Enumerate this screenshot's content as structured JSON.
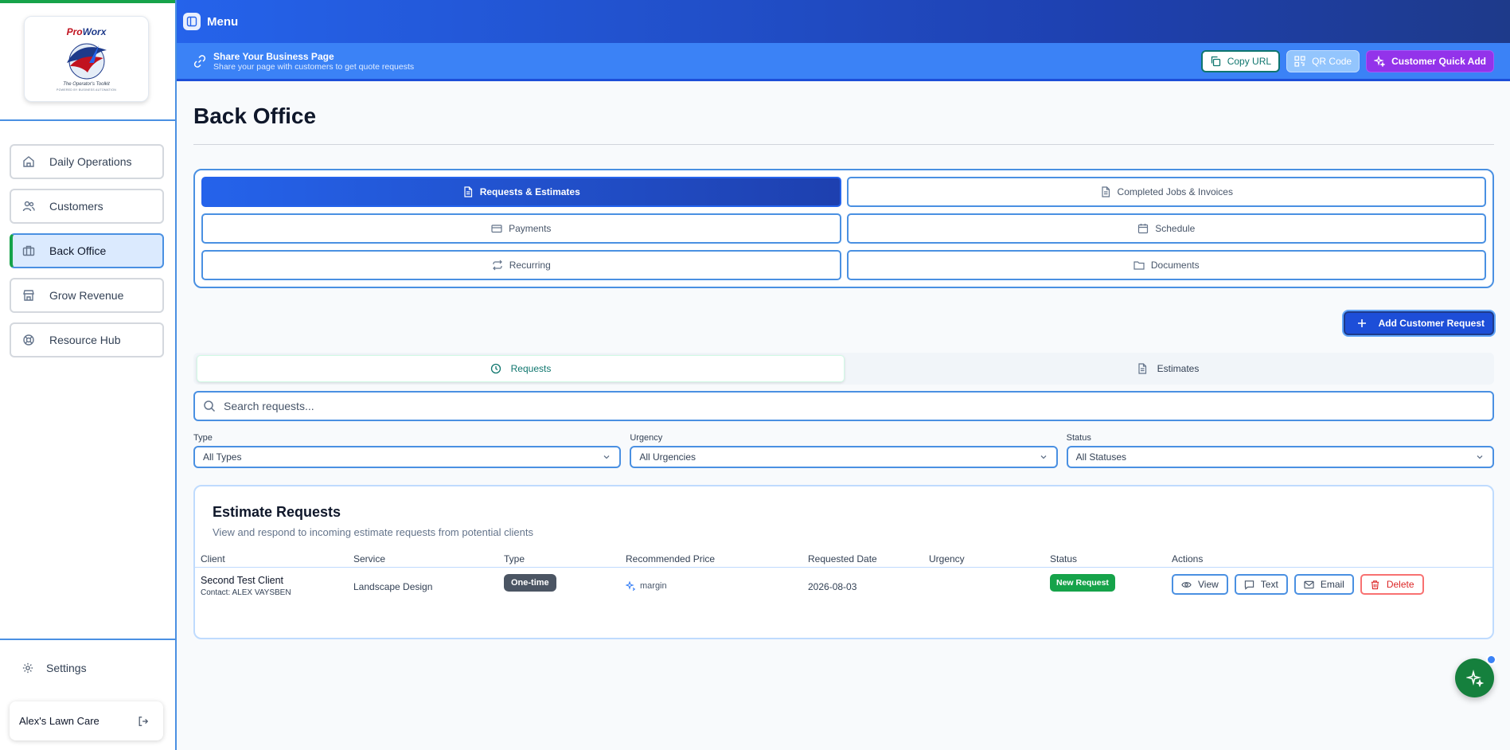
{
  "sidebar": {
    "logo": {
      "brand_a": "Pro",
      "brand_b": "Worx",
      "tagline": "The Operator's Toolkit",
      "subline": "POWERED BY BUSINESS AUTOMATION"
    },
    "items": [
      {
        "label": "Daily Operations",
        "icon": "home-icon"
      },
      {
        "label": "Customers",
        "icon": "users-icon"
      },
      {
        "label": "Back Office",
        "icon": "briefcase-icon",
        "active": true
      },
      {
        "label": "Grow Revenue",
        "icon": "store-icon"
      },
      {
        "label": "Resource Hub",
        "icon": "lifebuoy-icon"
      }
    ],
    "settings_label": "Settings",
    "business_name": "Alex's Lawn Care"
  },
  "topbar": {
    "menu_label": "Menu"
  },
  "sharebar": {
    "title": "Share Your Business Page",
    "subtitle": "Share your page with customers to get quote requests",
    "copy_url": "Copy URL",
    "qr_code": "QR Code",
    "quick_add": "Customer Quick Add"
  },
  "page": {
    "title": "Back Office"
  },
  "tabs": [
    {
      "label": "Requests & Estimates",
      "icon": "file-icon",
      "active": true
    },
    {
      "label": "Completed Jobs & Invoices",
      "icon": "file-icon"
    },
    {
      "label": "Payments",
      "icon": "credit-card-icon"
    },
    {
      "label": "Schedule",
      "icon": "calendar-icon"
    },
    {
      "label": "Recurring",
      "icon": "repeat-icon"
    },
    {
      "label": "Documents",
      "icon": "folder-icon"
    }
  ],
  "add_request_label": "Add Customer Request",
  "subtabs": [
    {
      "label": "Requests",
      "icon": "clock-icon",
      "active": true
    },
    {
      "label": "Estimates",
      "icon": "file-icon"
    }
  ],
  "search": {
    "placeholder": "Search requests..."
  },
  "filters": [
    {
      "label": "Type",
      "value": "All Types"
    },
    {
      "label": "Urgency",
      "value": "All Urgencies"
    },
    {
      "label": "Status",
      "value": "All Statuses"
    }
  ],
  "card": {
    "title": "Estimate Requests",
    "subtitle": "View and respond to incoming estimate requests from potential clients",
    "columns": [
      "Client",
      "Service",
      "Type",
      "Recommended Price",
      "Requested Date",
      "Urgency",
      "Status",
      "Actions"
    ],
    "rows": [
      {
        "client": "Second Test Client",
        "contact": "Contact: ALEX VAYSBEN",
        "service": "Landscape Design",
        "type": "One-time",
        "price": "margin",
        "date": "2026-08-03",
        "urgency": "",
        "status": "New Request",
        "actions": {
          "view": "View",
          "text": "Text",
          "email": "Email",
          "delete": "Delete"
        }
      }
    ]
  },
  "colors": {
    "primary": "#2563eb",
    "accent_green": "#16a34a",
    "purple": "#9333ea",
    "border_blue": "#4a90e2"
  }
}
